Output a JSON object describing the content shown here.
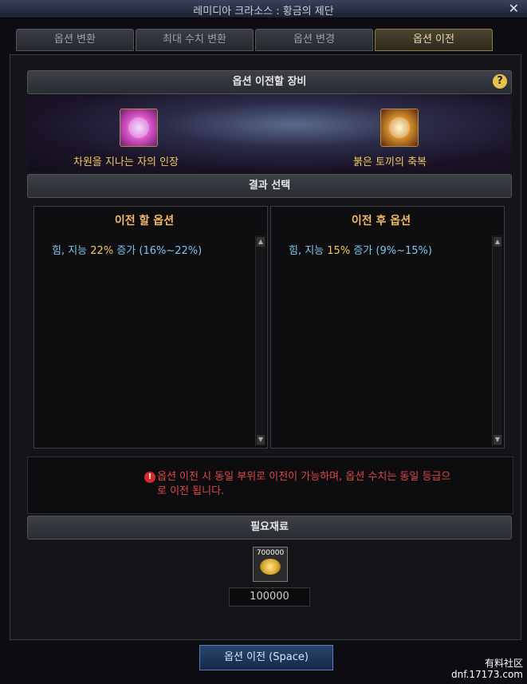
{
  "window": {
    "title": "레미디아 크라소스 : 황금의 제단",
    "close": "✕"
  },
  "tabs": [
    {
      "label": "옵션 변환"
    },
    {
      "label": "최대 수치 변환"
    },
    {
      "label": "옵션 변경"
    },
    {
      "label": "옵션 이전"
    }
  ],
  "equip_section": {
    "title": "옵션 이전할 장비",
    "help": "?"
  },
  "items": [
    {
      "name": "차원을 지나는 자의 인장"
    },
    {
      "name": "붉은 토끼의 축복"
    }
  ],
  "result_section": {
    "title": "결과 선택"
  },
  "panels": {
    "before": {
      "header": "이전 할 옵션",
      "option_prefix": "힘, 지능 ",
      "option_value": "22%",
      "option_suffix": " 증가 (16%~22%)"
    },
    "after": {
      "header": "이전 후 옵션",
      "option_prefix": "힘, 지능 ",
      "option_value": "15%",
      "option_suffix": " 증가 (9%~15%)"
    }
  },
  "notice": {
    "icon": "!",
    "text": "옵션 이전 시 동일 부위로 이전이 가능하며, 옵션 수치는 동일 등급으로 이전 됩니다."
  },
  "materials_section": {
    "title": "필요재료"
  },
  "cost": {
    "stack_count": "700000",
    "amount": "100000"
  },
  "action": {
    "label": "옵션 이전 (Space)"
  },
  "watermark": {
    "line1": "有料社区",
    "line2": "dnf.17173.com"
  }
}
